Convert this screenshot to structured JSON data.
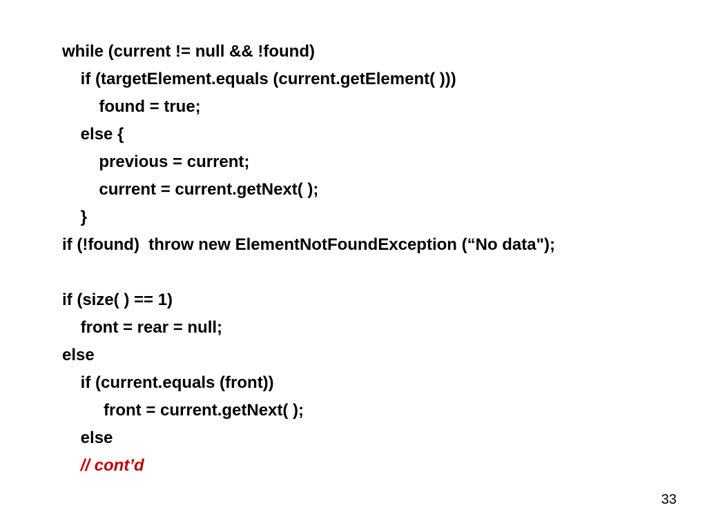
{
  "code": {
    "l1": "while (current != null && !found)",
    "l2": "    if (targetElement.equals (current.getElement( )))",
    "l3": "        found = true;",
    "l4": "    else {",
    "l5": "        previous = current;",
    "l6": "        current = current.getNext( );",
    "l7": "    }",
    "l8": "if (!found)  throw new ElementNotFoundException (“No data\");",
    "l9": "",
    "l10": "if (size( ) == 1)",
    "l11": "    front = rear = null;",
    "l12": "else",
    "l13": "    if (current.equals (front))",
    "l14": "         front = current.getNext( );",
    "l15": "    else",
    "l16p": "    ",
    "l16c": "// cont’d"
  },
  "pagenum": "33"
}
